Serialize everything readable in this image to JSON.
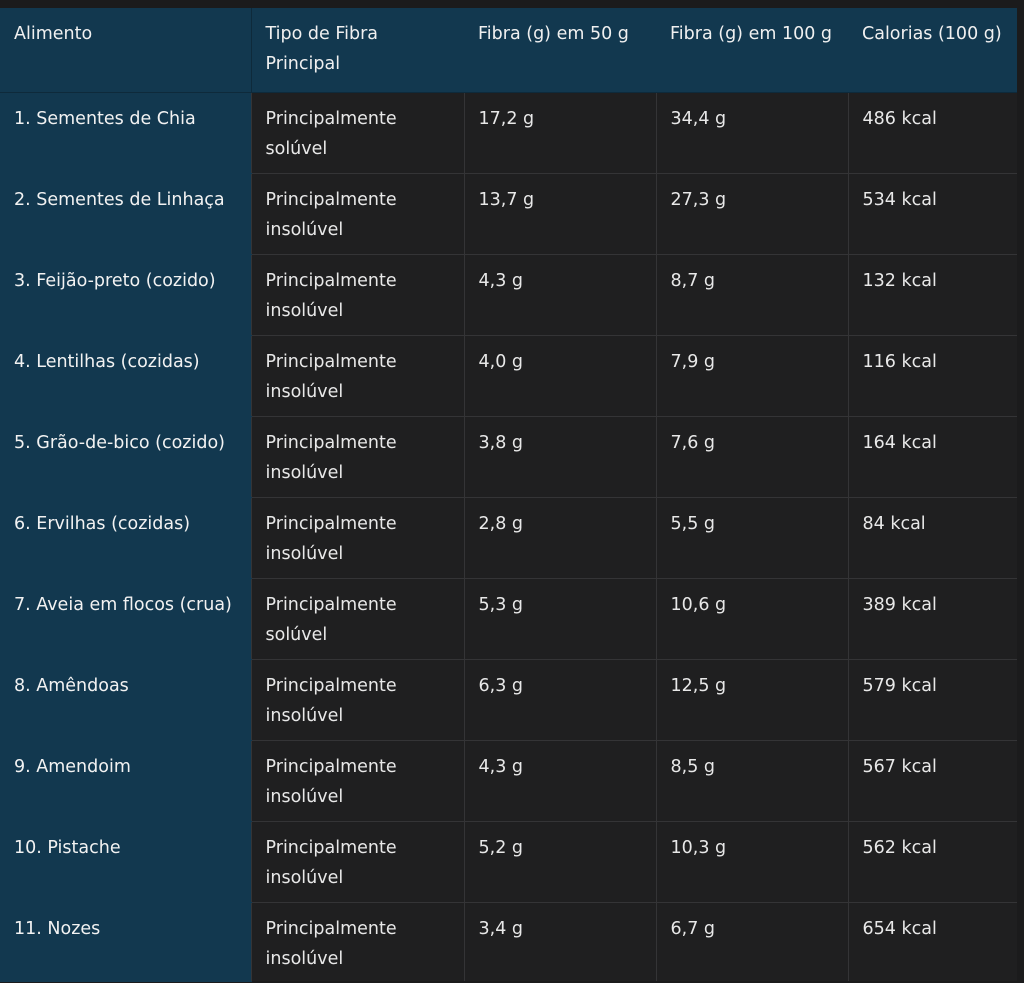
{
  "table": {
    "headers": [
      "Alimento",
      "Tipo de Fibra Principal",
      "Fibra (g) em 50 g",
      "Fibra (g) em 100 g",
      "Calorias (100 g)"
    ],
    "rows": [
      [
        "1. Sementes de Chia",
        "Principalmente solúvel",
        "17,2 g",
        "34,4 g",
        "486 kcal"
      ],
      [
        "2. Sementes de Linhaça",
        "Principalmente insolúvel",
        "13,7 g",
        "27,3 g",
        "534 kcal"
      ],
      [
        "3. Feijão-preto (cozido)",
        "Principalmente insolúvel",
        "4,3 g",
        "8,7 g",
        "132 kcal"
      ],
      [
        "4. Lentilhas (cozidas)",
        "Principalmente insolúvel",
        "4,0 g",
        "7,9 g",
        "116 kcal"
      ],
      [
        "5. Grão-de-bico (cozido)",
        "Principalmente insolúvel",
        "3,8 g",
        "7,6 g",
        "164 kcal"
      ],
      [
        "6. Ervilhas (cozidas)",
        "Principalmente insolúvel",
        "2,8 g",
        "5,5 g",
        "84 kcal"
      ],
      [
        "7. Aveia em flocos (crua)",
        "Principalmente solúvel",
        "5,3 g",
        "10,6 g",
        "389 kcal"
      ],
      [
        "8. Amêndoas",
        "Principalmente insolúvel",
        "6,3 g",
        "12,5 g",
        "579 kcal"
      ],
      [
        "9. Amendoim",
        "Principalmente insolúvel",
        "4,3 g",
        "8,5 g",
        "567 kcal"
      ],
      [
        "10. Pistache",
        "Principalmente insolúvel",
        "5,2 g",
        "10,3 g",
        "562 kcal"
      ],
      [
        "11. Nozes",
        "Principalmente insolúvel",
        "3,4 g",
        "6,7 g",
        "654 kcal"
      ]
    ]
  },
  "colors": {
    "header_bg": "#12384f",
    "cell_bg": "#1f1f20",
    "page_bg": "#1b1b1c",
    "grid_line": "#343436"
  }
}
